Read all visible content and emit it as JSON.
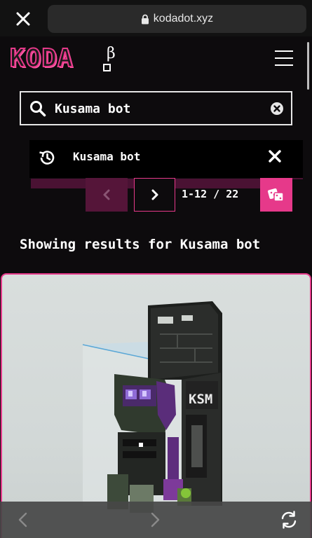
{
  "browser": {
    "url": "kodadot.xyz",
    "icons": {
      "close": "close-icon",
      "lock": "lock-icon",
      "back": "chevron-left-icon",
      "forward": "chevron-right-icon",
      "reload": "reload-icon"
    }
  },
  "header": {
    "logo_text": "KODA",
    "beta_mark": "β",
    "menu_icon": "hamburger-icon"
  },
  "search": {
    "value": "Kusama bot",
    "icons": {
      "search": "search-icon",
      "clear": "clear-circle-icon"
    }
  },
  "suggestion": {
    "label": "Kusama bot",
    "icons": {
      "history": "history-icon",
      "remove": "close-icon"
    }
  },
  "pagination": {
    "range": "1-12 / 22",
    "icons": {
      "prev": "chevron-left-icon",
      "next": "chevron-right-icon",
      "random": "dice-icon"
    }
  },
  "results": {
    "heading": "Showing results for Kusama bot"
  },
  "card": {
    "art_text": "KSM"
  },
  "colors": {
    "accent": "#e6398a",
    "accent_dark": "#551539",
    "background": "#0d0b0d",
    "browser_chrome": "#121212"
  }
}
